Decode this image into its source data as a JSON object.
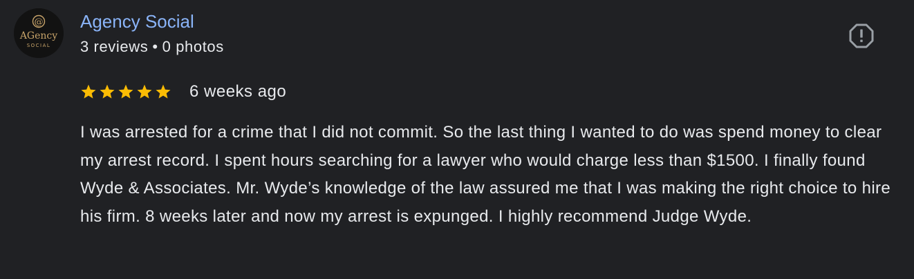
{
  "author": {
    "name": "Agency Social",
    "reviews_count": "3 reviews",
    "separator": "•",
    "photos_count": "0 photos",
    "avatar": {
      "icon": "agency-social-logo",
      "logo_lines": [
        "@",
        "AGency",
        "SOCIAL"
      ],
      "colors": {
        "background": "#121212",
        "gold": "#c8a46a"
      }
    }
  },
  "flag_icon": "report-flag-icon",
  "rating": {
    "stars": 5,
    "max_stars": 5,
    "star_color": "#fbbc04",
    "time_ago": "6 weeks ago"
  },
  "review_text": "I was arrested for a crime that I did not commit. So the last thing I wanted to do was spend money to clear my arrest record. I spent hours searching for a lawyer who would charge less than $1500. I finally found Wyde & Associates. Mr. Wyde’s knowledge of the law assured me that I was making the right choice to hire his firm. 8 weeks later and now my arrest is expunged. I highly recommend Judge Wyde.",
  "colors": {
    "background": "#202124",
    "author_name": "#8ab4f8",
    "text": "#e8eaed",
    "icon": "#9aa0a6"
  }
}
